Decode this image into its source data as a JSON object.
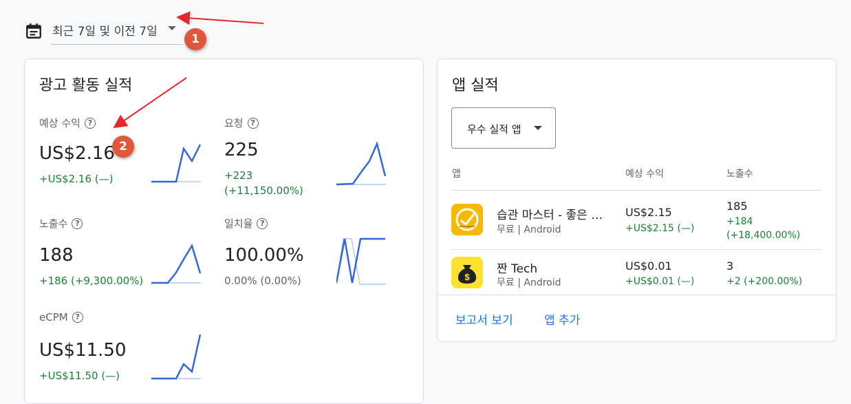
{
  "date_range": {
    "label": "최근 7일 및 이전 7일"
  },
  "ad_performance": {
    "title": "광고 활동 실적",
    "metrics": [
      {
        "label": "예상 수익",
        "value": "US$2.16",
        "delta": "+US$2.16 (—)"
      },
      {
        "label": "요청",
        "value": "225",
        "delta_line1": "+223",
        "delta_line2": "(+11,150.00%)"
      },
      {
        "label": "노출수",
        "value": "188",
        "delta": "+186 (+9,300.00%)"
      },
      {
        "label": "일치율",
        "value": "100.00%",
        "delta": "0.00% (0.00%)"
      },
      {
        "label": "eCPM",
        "value": "US$11.50",
        "delta": "+US$11.50 (—)"
      }
    ]
  },
  "app_performance": {
    "title": "앱 실적",
    "filter": {
      "selected": "우수 실적 앱"
    },
    "columns": [
      "앱",
      "예상 수익",
      "노출수"
    ],
    "rows": [
      {
        "name": "습관 마스터 - 좋은 …",
        "platform": "무료 | Android",
        "revenue": "US$2.15",
        "revenue_delta": "+US$2.15 (—)",
        "impressions": "185",
        "impressions_delta_1": "+184",
        "impressions_delta_2": "(+18,400.00%)",
        "icon": "habit-master-icon",
        "icon_color": "#f6b800"
      },
      {
        "name": "짠 Tech",
        "platform": "무료 | Android",
        "revenue": "US$0.01",
        "revenue_delta": "+US$0.01 (—)",
        "impressions": "3",
        "impressions_delta": "+2 (+200.00%)",
        "icon": "money-bag-icon",
        "icon_color": "#fbe232"
      }
    ],
    "links": {
      "report": "보고서 보기",
      "add_app": "앱 추가"
    }
  },
  "annotations": {
    "badge_1": "1",
    "badge_2": "2"
  },
  "colors": {
    "link": "#1a73e8",
    "positive": "#188038",
    "sparkline": "#3367d6",
    "badge": "#e0573a",
    "arrow": "#e8252b"
  }
}
